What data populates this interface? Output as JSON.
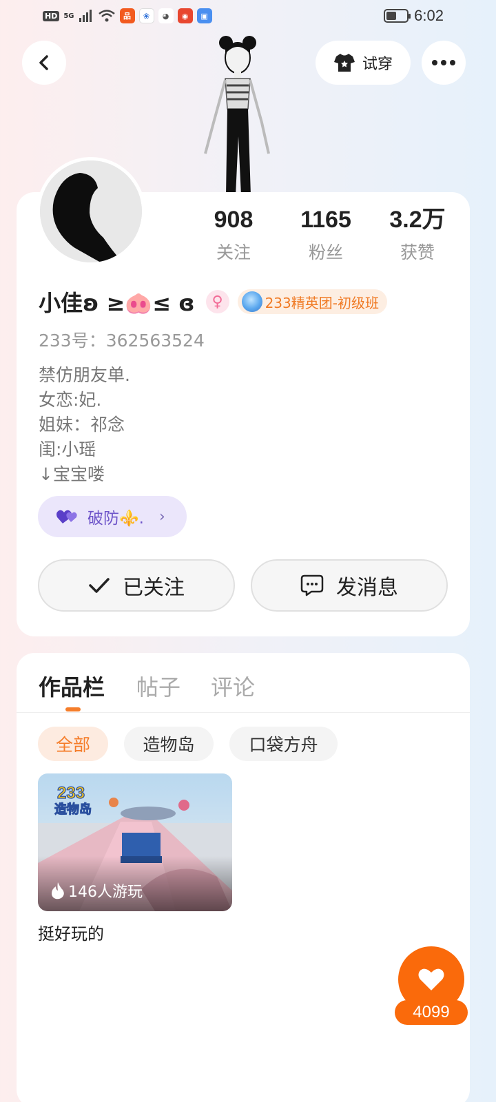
{
  "status_bar": {
    "network_badge": "HD",
    "signal_label": "5G",
    "time": "6:02"
  },
  "header": {
    "try_on_label": "试穿"
  },
  "profile": {
    "stats": [
      {
        "value": "908",
        "label": "关注"
      },
      {
        "value": "1165",
        "label": "粉丝"
      },
      {
        "value": "3.2万",
        "label": "获赞"
      }
    ],
    "name": "小佳ʚ ≥🐽≤ ɞ",
    "level_badge": "233精英团-初级班",
    "uid": "233号：362563524",
    "bio": [
      "禁仿朋友单.",
      "女恋:妃.",
      "姐妹：祁念",
      "闺:小瑶",
      "↓宝宝喽"
    ],
    "group_label": "破防⚜️.",
    "follow_label": "已关注",
    "message_label": "发消息"
  },
  "works": {
    "tabs": [
      "作品栏",
      "帖子",
      "评论"
    ],
    "filters": [
      "全部",
      "造物岛",
      "口袋方舟"
    ],
    "items": [
      {
        "thumb_logo": "233",
        "thumb_logo_sub": "造物岛",
        "play_count": "146人游玩",
        "title": "挺好玩的"
      }
    ]
  },
  "like_count": "4099",
  "colors": {
    "accent": "#fa6a0b",
    "tab_indicator": "#f57d2a",
    "group_pill_bg": "#ebe6fb",
    "group_pill_text": "#6e55c9"
  }
}
